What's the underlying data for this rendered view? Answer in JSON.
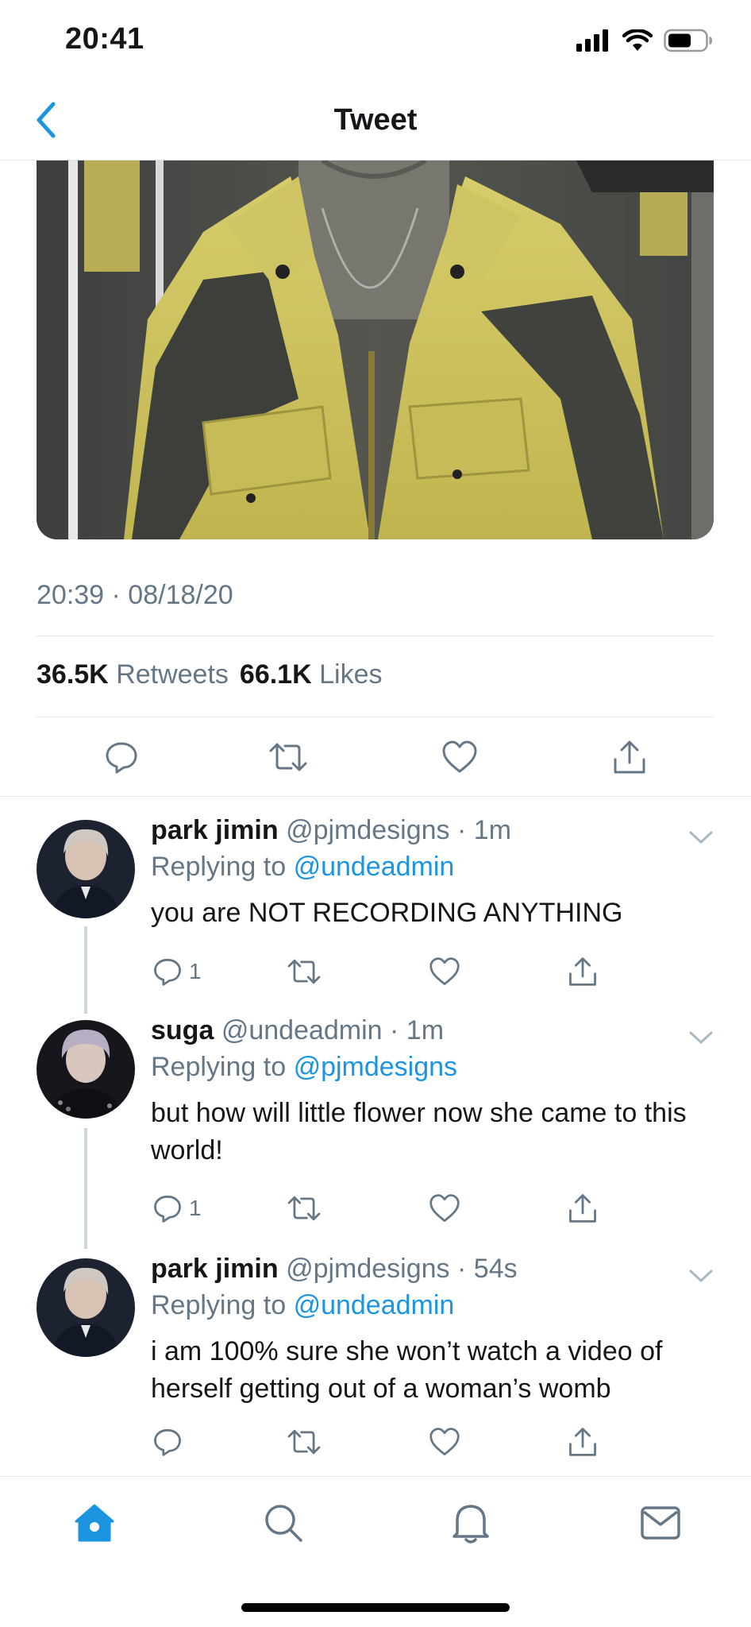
{
  "status_bar": {
    "time": "20:41"
  },
  "header": {
    "title": "Tweet"
  },
  "tweet": {
    "timestamp": "20:39 · 08/18/20",
    "retweets_count": "36.5K",
    "retweets_label": "Retweets",
    "likes_count": "66.1K",
    "likes_label": "Likes"
  },
  "replies": [
    {
      "name": "park jimin",
      "handle": "@pjmdesigns",
      "time": "1m",
      "replying_prefix": "Replying to",
      "replying_to": "@undeadmin",
      "text": "you are NOT RECORDING ANYTHING",
      "reply_count": "1"
    },
    {
      "name": "suga",
      "handle": "@undeadmin",
      "time": "1m",
      "replying_prefix": "Replying to",
      "replying_to": "@pjmdesigns",
      "text": "but how will little flower now she came to this world!",
      "reply_count": "1"
    },
    {
      "name": "park jimin",
      "handle": "@pjmdesigns",
      "time": "54s",
      "replying_prefix": "Replying to",
      "replying_to": "@undeadmin",
      "text": "i am 100% sure she won’t watch a video of herself getting out of a woman’s womb",
      "reply_count": ""
    }
  ],
  "tab_bar": {
    "tabs": [
      "home-icon",
      "search-icon",
      "bell-icon",
      "mail-icon"
    ],
    "active": "home-icon"
  },
  "colors": {
    "accent": "#1b95e0",
    "text_primary": "#14171a",
    "text_secondary": "#657786",
    "divider": "#e1e8ed"
  }
}
